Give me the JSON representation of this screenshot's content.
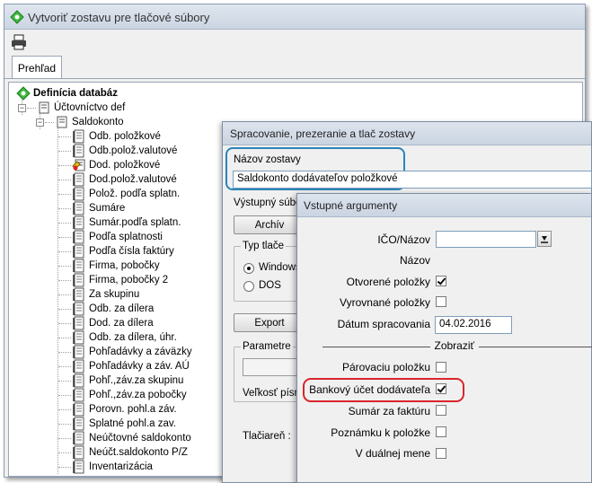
{
  "window": {
    "title": "Vytvoriť zostavu pre tlačové súbory",
    "tab_label": "Prehľad"
  },
  "tree": {
    "root": "Definícia databáz",
    "group": "Účtovníctvo def",
    "subgroup": "Saldokonto",
    "items": [
      "Odb. položkové",
      "Odb.polož.valutové",
      "Dod. položkové",
      "Dod.polož.valutové",
      "Polož. podľa splatn.",
      "Sumáre",
      "Sumár.podľa splatn.",
      "Podľa splatnosti",
      "Podľa čísla faktúry",
      "Firma, pobočky",
      "Firma, pobočky 2",
      "Za skupinu",
      "Odb. za dílera",
      "Dod. za dílera",
      "Odb. za dílera, úhr.",
      "Pohľadávky a záväzky",
      "Pohľadávky a záv. AÚ",
      "Pohľ.,záv.za skupinu",
      "Pohľ.,záv.za pobočky",
      "Porovn. pohl.a záv.",
      "Splatné pohl.a zav.",
      "Neúčtovné saldokonto",
      "Neúčt.saldokonto P/Z",
      "Inventarizácia"
    ],
    "selected_index": 2
  },
  "proc_dialog": {
    "title": "Spracovanie, prezeranie a tlač zostavy",
    "name_label": "Názov zostavy",
    "name_value": "Saldokonto dodávateľov položkové",
    "output_file_label": "Výstupný súbor",
    "archive_button": "Archív",
    "print_type_label": "Typ tlače",
    "radio_windows": "Windows",
    "radio_dos": "DOS",
    "export_button": "Export",
    "params_label": "Parametre",
    "font_size_label": "Veľkosť písm",
    "printer_label": "Tlačiareň :"
  },
  "args_dialog": {
    "title": "Vstupné argumenty",
    "ico_label": "IČO/Názov",
    "ico_value": "",
    "nazov_label": "Názov",
    "open_items_label": "Otvorené položky",
    "open_items_checked": true,
    "closed_items_label": "Vyrovnané položky",
    "closed_items_checked": false,
    "date_label": "Dátum spracovania",
    "date_value": "04.02.2016",
    "show_label": "Zobraziť",
    "pairing_label": "Párovaciu položku",
    "pairing_checked": false,
    "bank_label": "Bankový účet dodávateľa",
    "bank_checked": true,
    "sum_label": "Sumár za faktúru",
    "sum_checked": false,
    "note_label": "Poznámku k položke",
    "note_checked": false,
    "dual_label": "V duálnej mene",
    "dual_checked": false
  },
  "colors": {
    "highlight_blue": "#2a84b8",
    "highlight_red": "#d9252c",
    "root_icon_green": "#3dbb3d",
    "doc_icon": "#555555"
  }
}
